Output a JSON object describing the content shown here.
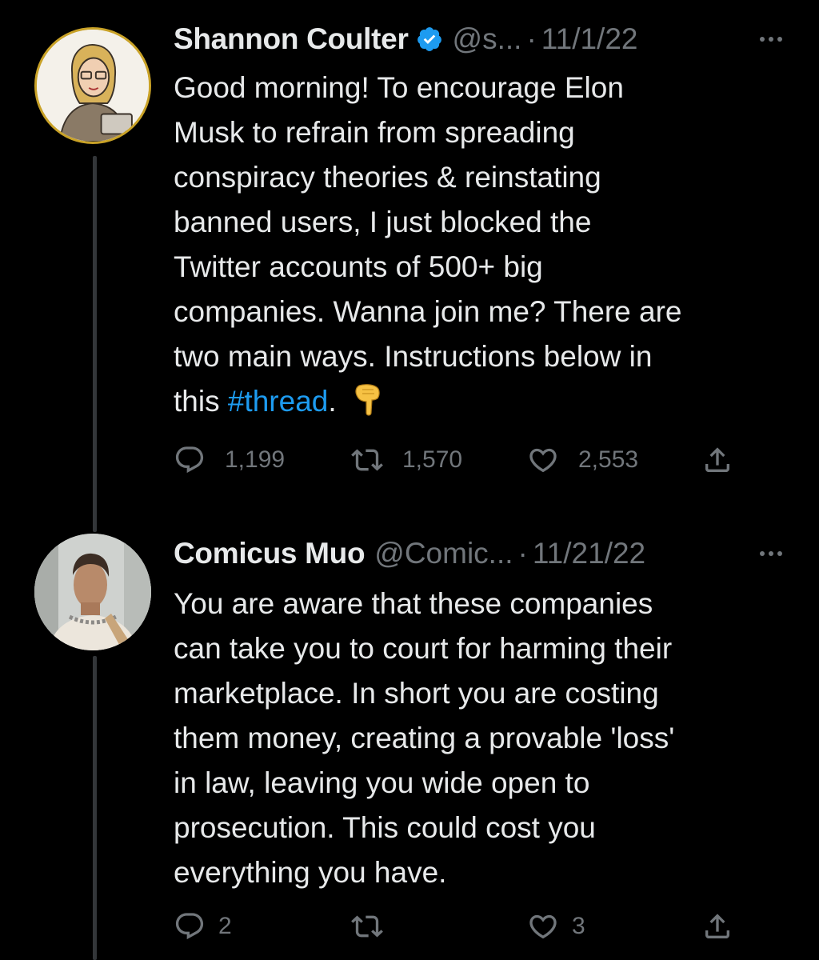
{
  "tweets": [
    {
      "author": {
        "name": "Shannon Coulter",
        "handle": "@s...",
        "verified": true
      },
      "date": "11/1/22",
      "text_before": "Good morning! To encourage Elon\nMusk to refrain from spreading\nconspiracy theories & reinstating\nbanned users, I just blocked the\nTwitter accounts of 500+ big\ncompanies. Wanna join me? There are\ntwo main ways. Instructions below in\nthis ",
      "hashtag": "#thread",
      "text_after": ".",
      "emoji": "backhand-index-pointing-down",
      "counts": {
        "replies": "1,199",
        "retweets": "1,570",
        "likes": "2,553"
      }
    },
    {
      "author": {
        "name": "Comicus Muo",
        "handle": "@Comic...",
        "verified": false
      },
      "date": "11/21/22",
      "text": "You are aware that these companies\ncan take you to court for harming their\nmarketplace.  In short you are costing\nthem money, creating a provable 'loss'\nin law, leaving you wide open to\nprosecution.  This could cost you\neverything you have.",
      "counts": {
        "replies": "2",
        "retweets": "",
        "likes": "3"
      }
    }
  ],
  "separator": "·",
  "icons": [
    "verified-badge-icon",
    "more-icon",
    "reply-icon",
    "retweet-icon",
    "like-icon",
    "share-icon"
  ],
  "colors": {
    "background": "#000000",
    "text": "#e7e9ea",
    "secondary": "#71767b",
    "link": "#1d9bf0",
    "verified": "#1d9bf0"
  }
}
